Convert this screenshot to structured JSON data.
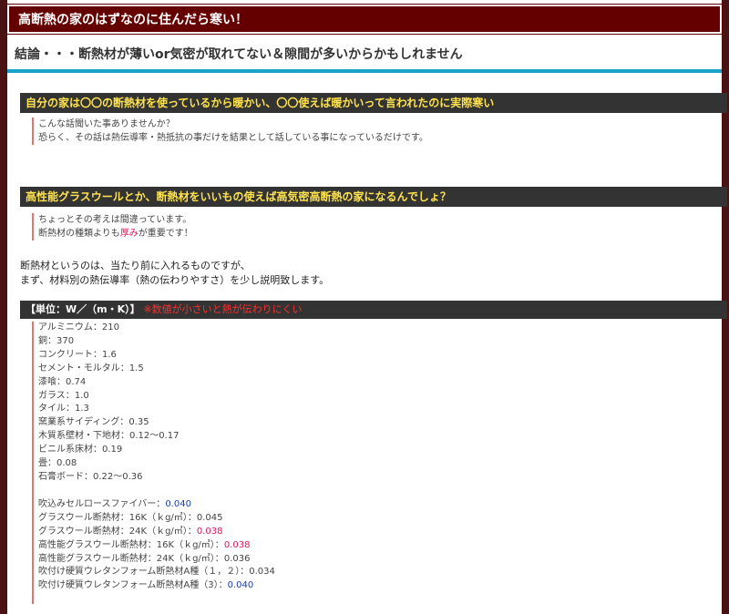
{
  "page_title": "高断熱の家のはずなのに住んだら寒い！",
  "conclusion": "結論・・・断熱材が薄いor気密が取れてない＆隙間が多いからかもしれません",
  "section1": {
    "heading": "自分の家は〇〇の断熱材を使っているから暖かい、〇〇使えば暖かいって言われたのに実際寒い",
    "lines": [
      "こんな話聞いた事ありませんか？",
      "恐らく、その話は熱伝導率・熱抵抗の事だけを結果として話している事になっているだけです。"
    ]
  },
  "section2": {
    "heading": "高性能グラスウールとか、断熱材をいいもの使えば高気密高断熱の家になるんでしょ？",
    "line1": "ちょっとその考えは間違っています。",
    "line2_a": "断熱材の種類よりも",
    "line2_em": "厚み",
    "line2_b": "が重要です！"
  },
  "intro": {
    "line1": "断熱材というのは、当たり前に入れるものですが、",
    "line2": "まず、材料別の熱伝導率（熱の伝わりやすさ）を少し説明致します。"
  },
  "unit": {
    "label": "【単位：W／（m・K）】",
    "note": "※数値が小さいと熱が伝わりにくい"
  },
  "materials_a": [
    {
      "name": "アルミニウム：",
      "value": "210"
    },
    {
      "name": "銅：",
      "value": "370"
    },
    {
      "name": "コンクリート：",
      "value": "1.6"
    },
    {
      "name": "セメント・モルタル：",
      "value": "1.5"
    },
    {
      "name": "漆喰：",
      "value": "0.74"
    },
    {
      "name": "ガラス：",
      "value": "1.0"
    },
    {
      "name": "タイル：",
      "value": "1.3"
    },
    {
      "name": "窯業系サイディング：",
      "value": "0.35"
    },
    {
      "name": "木質系壁材・下地材：",
      "value": "0.12〜0.17"
    },
    {
      "name": "ビニル系床材：",
      "value": "0.19"
    },
    {
      "name": "畳：",
      "value": "0.08"
    },
    {
      "name": "石膏ボード：",
      "value": "0.22〜0.36"
    }
  ],
  "materials_b": [
    {
      "name": "吹込みセルロースファイバー：",
      "value": "0.040",
      "color": "#1a3fb5"
    },
    {
      "name": "グラスウール断熱材：16K（ｋg/㎥）：",
      "value": "0.045",
      "color": ""
    },
    {
      "name": "グラスウール断熱材：24K（ｋg/㎥）：",
      "value": "0.038",
      "color": "#e0145d"
    },
    {
      "name": "高性能グラスウール断熱材：16K（ｋg/㎥）：",
      "value": "0.038",
      "color": "#e0145d"
    },
    {
      "name": "高性能グラスウール断熱材：24K（ｋg/㎥）：",
      "value": "0.036",
      "color": ""
    },
    {
      "name": "吹付け硬質ウレタンフォーム断熱材A種（１，２）：",
      "value": "0.034",
      "color": ""
    },
    {
      "name": "吹付け硬質ウレタンフォーム断熱材A種（3）：",
      "value": "0.040",
      "color": "#1a3fb5"
    }
  ]
}
